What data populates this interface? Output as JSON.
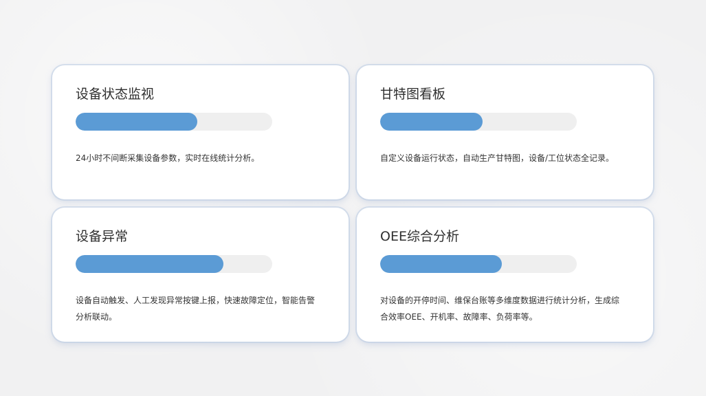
{
  "colors": {
    "accent": "#5b9bd5",
    "track": "#efefef",
    "card": "#ffffff",
    "background": "#f1f1f2"
  },
  "cards": [
    {
      "title": "设备状态监视",
      "progress": 0.62,
      "description": "24小时不间断采集设备参数，实时在线统计分析。"
    },
    {
      "title": "甘特图看板",
      "progress": 0.52,
      "description": "自定义设备运行状态，自动生产甘特图，设备/工位状态全记录。"
    },
    {
      "title": "设备异常",
      "progress": 0.75,
      "description": "设备自动触发、人工发现异常按键上报，快速故障定位，智能告警分析联动。"
    },
    {
      "title": "OEE综合分析",
      "progress": 0.62,
      "description": "对设备的开停时间、维保台账等多维度数据进行统计分析，生成综合效率OEE、开机率、故障率、负荷率等。"
    }
  ]
}
